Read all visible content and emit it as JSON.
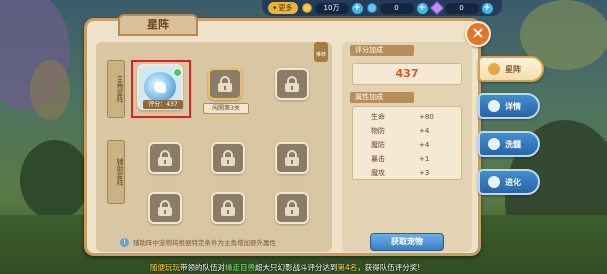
{
  "topbar": {
    "more_label": "更多",
    "coins": "10万",
    "diamonds": "0",
    "gems": "0",
    "plus_symbol": "+"
  },
  "panel": {
    "title": "星阵",
    "close_symbol": "×",
    "main_formation_label": "主角星阵",
    "aux_formation_label": "辅助星阵",
    "active_pet_score": "评分：437",
    "unlock_hint": "闯関第3关",
    "reward_tag": "推荐",
    "tip_text": "辅助阵中宠物将根据特定条件为主角增加额外属性",
    "tip_icon": "!"
  },
  "stats": {
    "score_header": "评分加成",
    "score_value": "437",
    "attr_header": "属性加成",
    "attributes": [
      {
        "name": "生命",
        "value": "+80"
      },
      {
        "name": "物防",
        "value": "+4"
      },
      {
        "name": "魔防",
        "value": "+4"
      },
      {
        "name": "暴击",
        "value": "+1"
      },
      {
        "name": "魔攻",
        "value": "+3"
      }
    ],
    "get_pet_button": "获取宠物"
  },
  "side_tabs": [
    {
      "label": "星阵",
      "icon": "star-icon"
    },
    {
      "label": "详情",
      "icon": "paw-icon"
    },
    {
      "label": "洗髓",
      "icon": "book-icon"
    },
    {
      "label": "进化",
      "icon": "evolve-icon"
    }
  ],
  "marquee": {
    "prefix": "随便玩玩",
    "part1": "带领的队伍对",
    "boss": "缘走目兽",
    "part2": "超大只幻影战斗评分达到",
    "rank": "第4名",
    "part3": "，获得队伍评分奖!"
  }
}
